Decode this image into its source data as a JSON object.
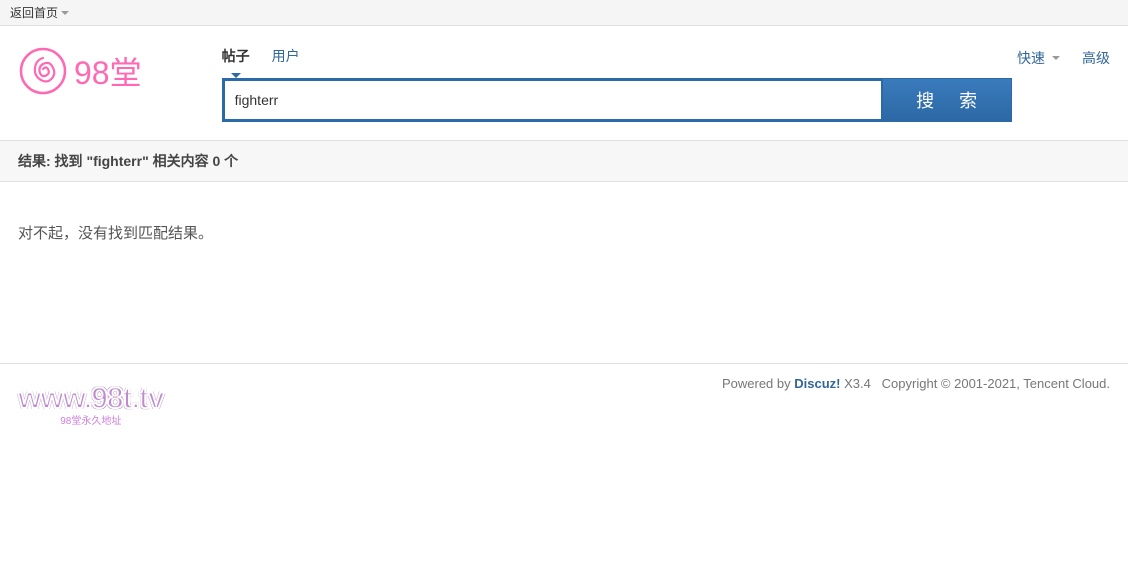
{
  "topbar": {
    "home_link": "返回首页"
  },
  "logo": {
    "text": "98堂"
  },
  "search": {
    "tabs": {
      "posts": "帖子",
      "users": "用户"
    },
    "quick": "快速",
    "advanced": "高级",
    "value": "fighterr",
    "placeholder": "",
    "button": "搜 索"
  },
  "results": {
    "header": "结果: 找到 \"fighterr\" 相关内容 0 个",
    "no_result": "对不起，没有找到匹配结果。"
  },
  "footer": {
    "powered_by_prefix": "Powered by ",
    "discuz": "Discuz!",
    "version": " X3.4",
    "copyright": "Copyright © 2001-2021, Tencent Cloud.",
    "logo_text": "www.98t.tv",
    "logo_sub": "98堂永久地址"
  }
}
